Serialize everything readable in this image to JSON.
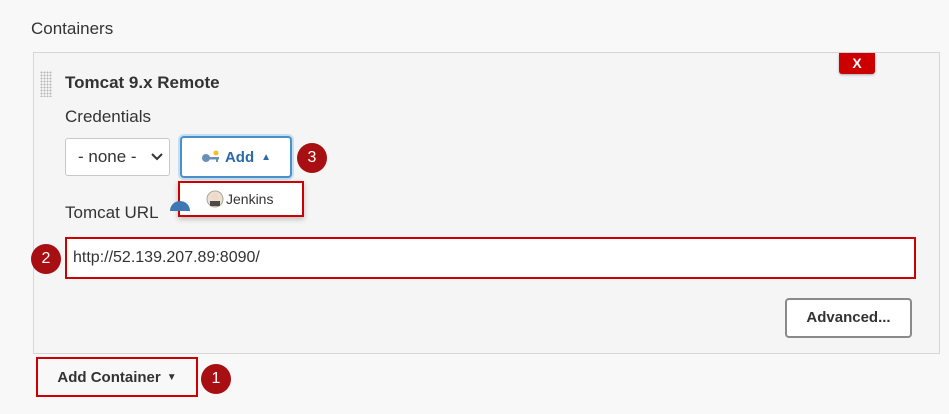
{
  "section": {
    "title": "Containers"
  },
  "container": {
    "name": "Tomcat 9.x Remote",
    "delete_label": "X",
    "credentials": {
      "label": "Credentials",
      "selected": "- none -",
      "add_label": "Add",
      "menu_items": [
        "Jenkins"
      ]
    },
    "tomcat_url": {
      "label": "Tomcat URL",
      "value": "http://52.139.207.89:8090/"
    },
    "advanced_label": "Advanced..."
  },
  "footer": {
    "add_container_label": "Add Container"
  },
  "callouts": [
    "1",
    "2",
    "3"
  ],
  "colors": {
    "annotation_red": "#cc0000",
    "badge_red": "#a80f12",
    "accent_blue": "#4a90c8"
  },
  "icons": [
    "drag-handle-icon",
    "key-icon",
    "caret-up-icon",
    "jenkins-icon",
    "help-icon",
    "caret-down-icon",
    "chevron-down-icon"
  ]
}
